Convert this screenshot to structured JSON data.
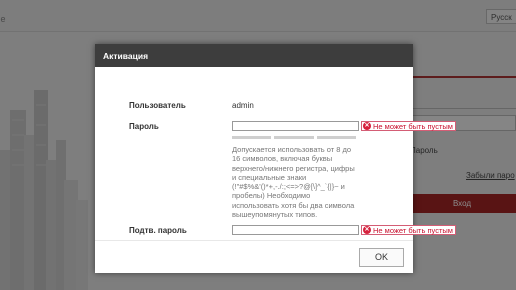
{
  "background": {
    "logo_fragment": "ıе",
    "language": "Русск",
    "password_label": "Пароль",
    "forgot_link": "Забыли паро",
    "login_button": "Вход"
  },
  "dialog": {
    "title": "Активация",
    "user_label": "Пользователь",
    "user_value": "admin",
    "password_label": "Пароль",
    "password_error": "Не может быть пустым",
    "password_strength_segments": 3,
    "hint_lines": [
      "Допускается использовать от 8 до",
      "16 символов, включая буквы",
      "верхнего/нижнего регистра, цифры",
      "и специальные знаки",
      "(!\"#$%&'()*+,-./:;<=>?@[\\]^_`{|}~ и",
      "пробелы) Необходимо",
      "использовать хотя бы два символа",
      "вышеупомянутых типов."
    ],
    "confirm_label": "Подтв. пароль",
    "confirm_error": "Не может быть пустым",
    "ok_button": "OK"
  },
  "colors": {
    "header_bg": "#3d3d3d",
    "error_red": "#c8102e",
    "login_red": "#a32525"
  }
}
